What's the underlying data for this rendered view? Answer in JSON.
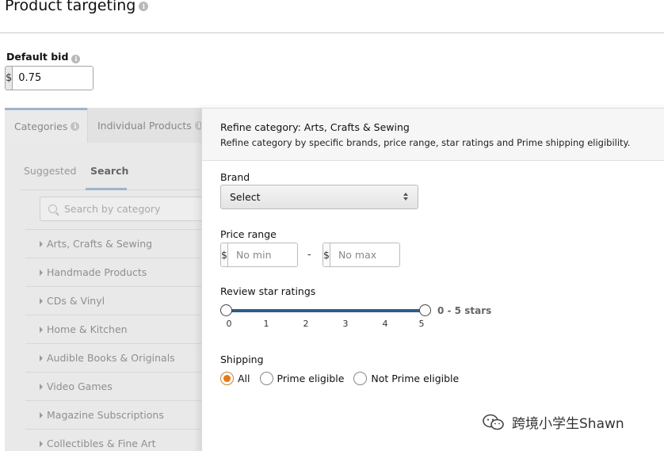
{
  "header": {
    "title": "Product targeting"
  },
  "default_bid": {
    "label": "Default bid",
    "currency": "$",
    "value": "0.75"
  },
  "left_panel": {
    "tabs": [
      {
        "label": "Categories"
      },
      {
        "label": "Individual Products"
      }
    ],
    "subtabs": [
      {
        "label": "Suggested"
      },
      {
        "label": "Search"
      }
    ],
    "search_placeholder": "Search by category",
    "categories": [
      "Arts, Crafts & Sewing",
      "Handmade Products",
      "CDs & Vinyl",
      "Home & Kitchen",
      "Audible Books & Originals",
      "Video Games",
      "Magazine Subscriptions",
      "Collectibles & Fine Art"
    ]
  },
  "refine": {
    "title": "Refine category: Arts, Crafts & Sewing",
    "subtitle": "Refine category by specific brands, price range, star ratings and Prime shipping eligibility.",
    "brand": {
      "label": "Brand",
      "selected": "Select"
    },
    "price": {
      "label": "Price range",
      "currency": "$",
      "min_placeholder": "No min",
      "max_placeholder": "No max",
      "separator": "-"
    },
    "rating": {
      "label": "Review star ratings",
      "value_text": "0 - 5 stars",
      "min": 0,
      "max": 5,
      "ticks": [
        "0",
        "1",
        "2",
        "3",
        "4",
        "5"
      ]
    },
    "shipping": {
      "label": "Shipping",
      "options": [
        {
          "label": "All",
          "checked": true
        },
        {
          "label": "Prime eligible",
          "checked": false
        },
        {
          "label": "Not Prime eligible",
          "checked": false
        }
      ]
    }
  },
  "watermark": {
    "text": "跨境小学生Shawn"
  },
  "colors": {
    "accent": "#e47911",
    "slider": "#2e5b8c"
  }
}
